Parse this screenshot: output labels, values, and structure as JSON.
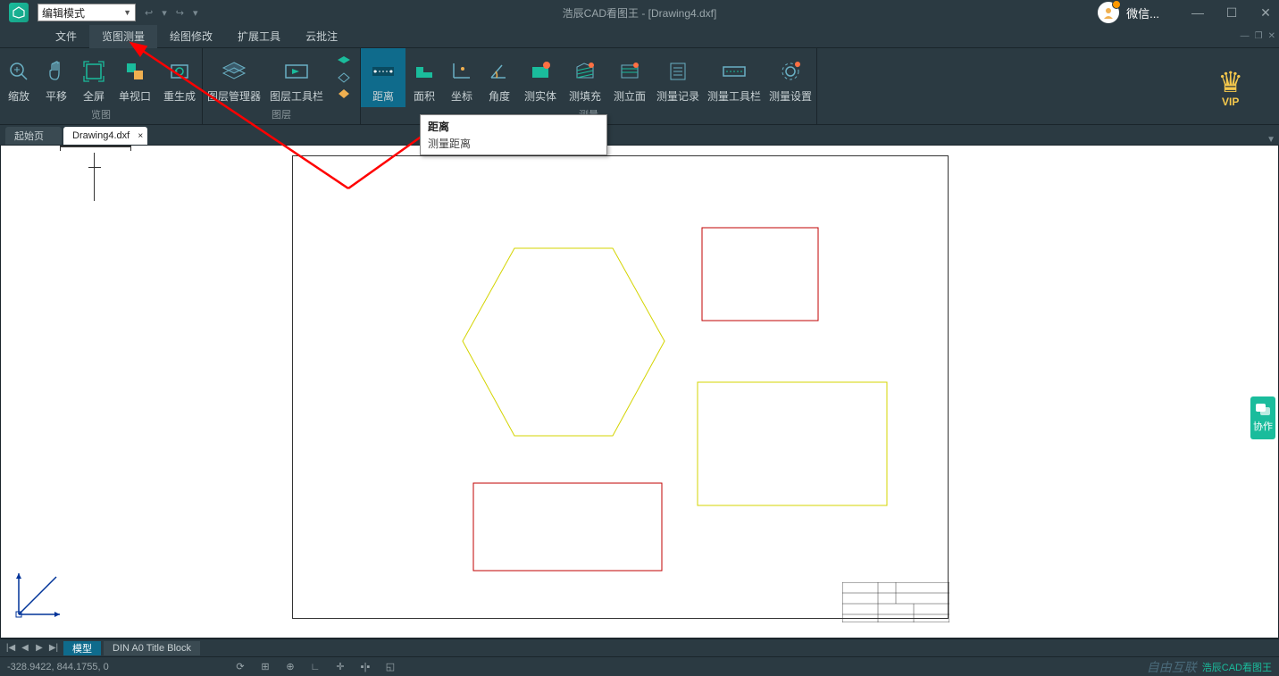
{
  "app": {
    "title": "浩辰CAD看图王 - [Drawing4.dxf]",
    "mode": "编辑模式",
    "wechat": "微信..."
  },
  "menus": {
    "file": "文件",
    "view_measure": "览图测量",
    "draw_edit": "绘图修改",
    "ext_tools": "扩展工具",
    "cloud_annot": "云批注"
  },
  "ribbon": {
    "group_view": "览图",
    "group_layer": "图层",
    "group_measure": "测量",
    "zoom": "缩放",
    "pan": "平移",
    "fullscreen": "全屏",
    "single_view": "单视口",
    "regen": "重生成",
    "layer_mgr": "图层管理器",
    "layer_toolbar": "图层工具栏",
    "distance": "距离",
    "area": "面积",
    "coord": "坐标",
    "angle": "角度",
    "entity": "测实体",
    "fill": "测填充",
    "elevation": "测立面",
    "record": "测量记录",
    "m_toolbar": "测量工具栏",
    "m_settings": "测量设置",
    "vip": "VIP"
  },
  "tooltip": {
    "title": "距离",
    "desc": "测量距离"
  },
  "tabs": {
    "start": "起始页",
    "drawing": "Drawing4.dxf"
  },
  "bottom_tabs": {
    "model": "模型",
    "layout1": "DIN A0 Title Block"
  },
  "status": {
    "coords": "-328.9422, 844.1755, 0",
    "brand": "浩辰CAD看图王",
    "watermark": "自由互联"
  },
  "collab": "协作"
}
